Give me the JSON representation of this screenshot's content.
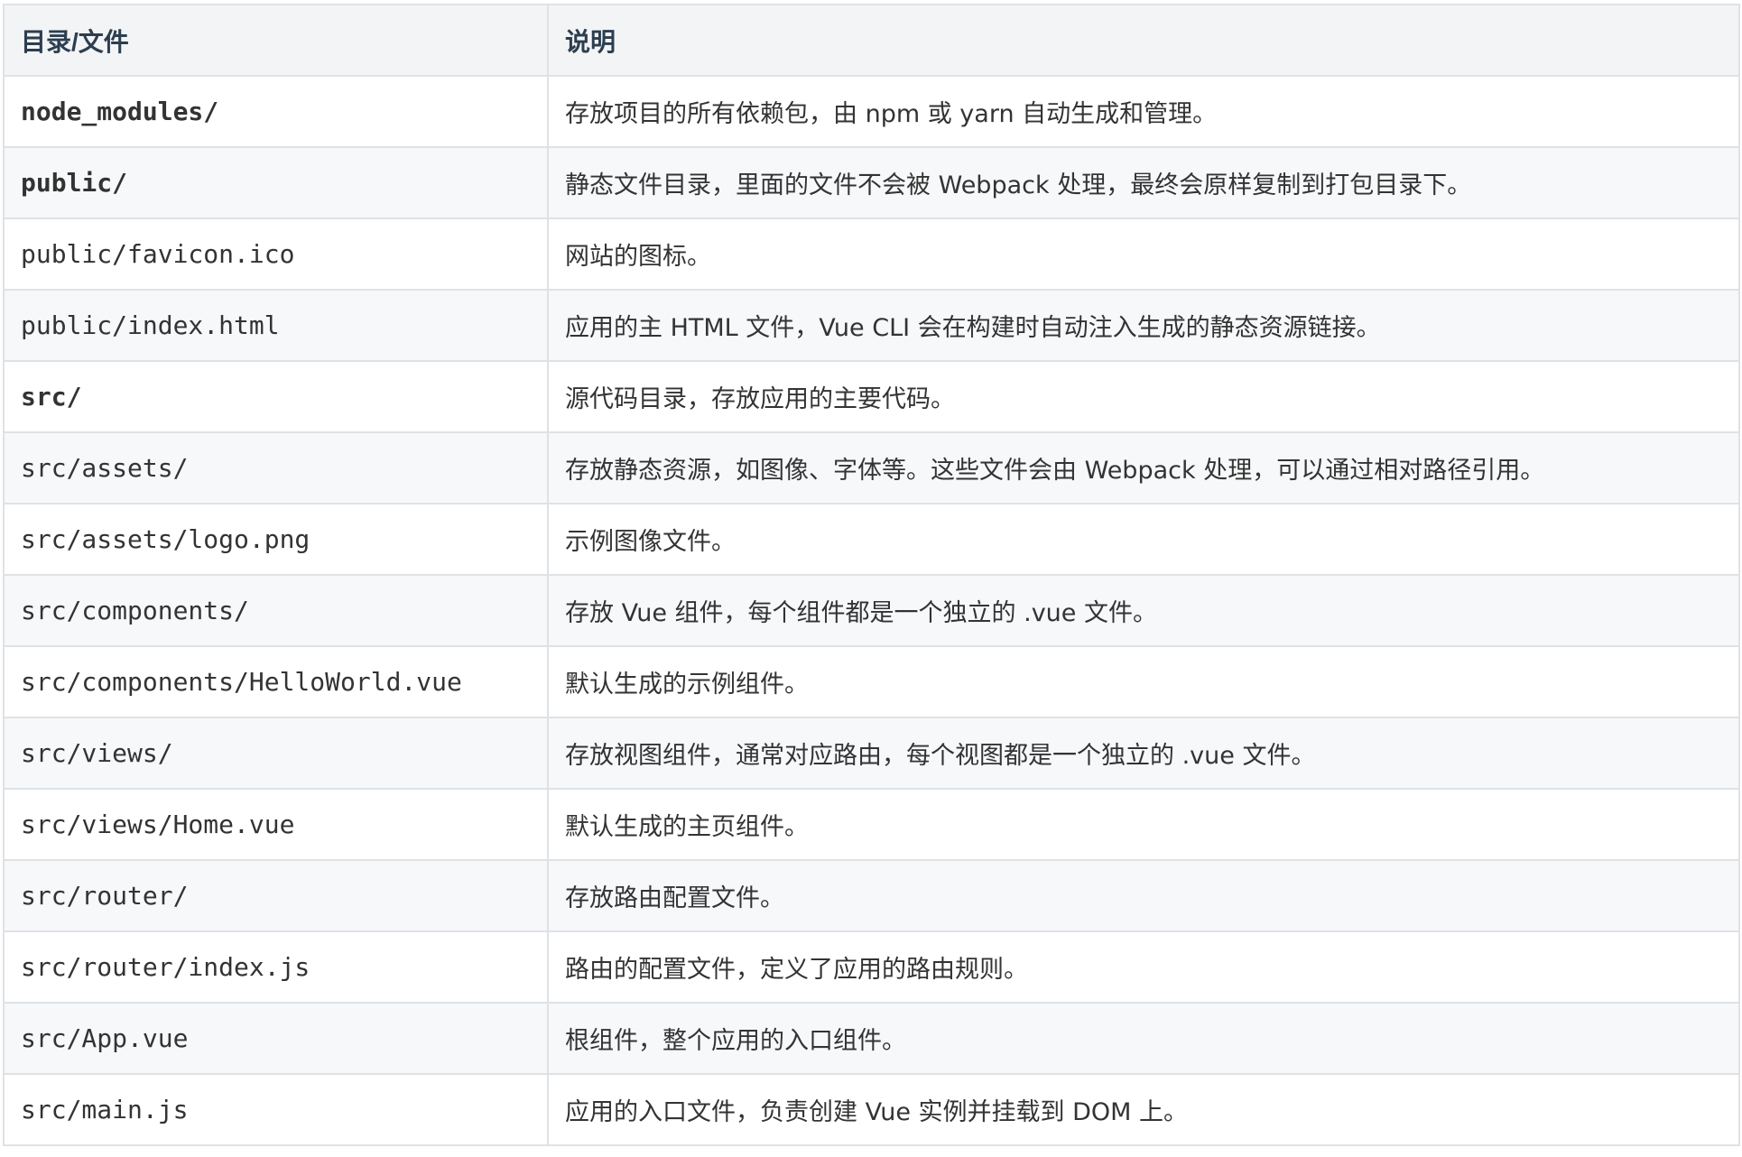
{
  "table": {
    "headers": [
      "目录/文件",
      "说明"
    ],
    "rows": [
      {
        "path": "node_modules/",
        "bold": true,
        "desc": "存放项目的所有依赖包，由 npm 或 yarn 自动生成和管理。"
      },
      {
        "path": "public/",
        "bold": true,
        "desc": "静态文件目录，里面的文件不会被 Webpack 处理，最终会原样复制到打包目录下。"
      },
      {
        "path": "public/favicon.ico",
        "bold": false,
        "desc": "网站的图标。"
      },
      {
        "path": "public/index.html",
        "bold": false,
        "desc": "应用的主 HTML 文件，Vue CLI 会在构建时自动注入生成的静态资源链接。"
      },
      {
        "path": "src/",
        "bold": true,
        "desc": "源代码目录，存放应用的主要代码。"
      },
      {
        "path": "src/assets/",
        "bold": false,
        "desc": "存放静态资源，如图像、字体等。这些文件会由 Webpack 处理，可以通过相对路径引用。"
      },
      {
        "path": "src/assets/logo.png",
        "bold": false,
        "desc": "示例图像文件。"
      },
      {
        "path": "src/components/",
        "bold": false,
        "desc": "存放 Vue 组件，每个组件都是一个独立的 .vue 文件。"
      },
      {
        "path": "src/components/HelloWorld.vue",
        "bold": false,
        "desc": "默认生成的示例组件。"
      },
      {
        "path": "src/views/",
        "bold": false,
        "desc": "存放视图组件，通常对应路由，每个视图都是一个独立的 .vue 文件。"
      },
      {
        "path": "src/views/Home.vue",
        "bold": false,
        "desc": "默认生成的主页组件。"
      },
      {
        "path": "src/router/",
        "bold": false,
        "desc": "存放路由配置文件。"
      },
      {
        "path": "src/router/index.js",
        "bold": false,
        "desc": "路由的配置文件，定义了应用的路由规则。"
      },
      {
        "path": "src/App.vue",
        "bold": false,
        "desc": "根组件，整个应用的入口组件。"
      },
      {
        "path": "src/main.js",
        "bold": false,
        "desc": "应用的入口文件，负责创建 Vue 实例并挂载到 DOM 上。"
      }
    ]
  }
}
